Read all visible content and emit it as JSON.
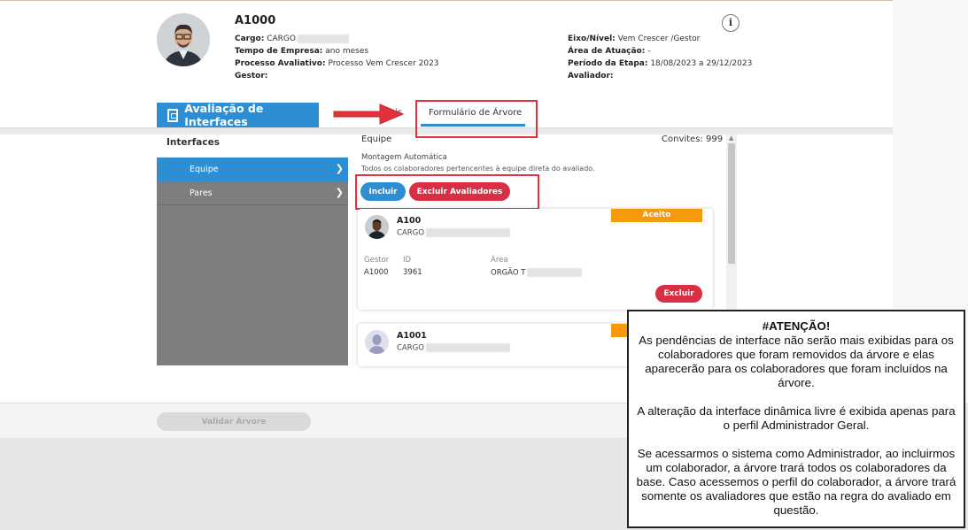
{
  "header": {
    "name": "A1000",
    "left": [
      {
        "label": "Cargo:",
        "value": "CARGO"
      },
      {
        "label": "Tempo de Empresa:",
        "value": "ano meses"
      },
      {
        "label": "Processo Avaliativo:",
        "value": "Processo Vem Crescer 2023"
      },
      {
        "label": "Gestor:",
        "value": ""
      }
    ],
    "right": [
      {
        "label": "Eixo/Nível:",
        "value": "Vem Crescer /Gestor"
      },
      {
        "label": "Área de Atuação:",
        "value": "-"
      },
      {
        "label": "Período da Etapa:",
        "value": "18/08/2023 a 29/12/2023"
      },
      {
        "label": "Avaliador:",
        "value": ""
      }
    ],
    "info_icon": "i"
  },
  "title_tab": "Avaliação de Interfaces",
  "tabs": {
    "left_partial": "ais",
    "tree": "Formulário de Árvore"
  },
  "sidebar": {
    "title": "Interfaces",
    "items": [
      {
        "label": "Equipe"
      },
      {
        "label": "Pares"
      }
    ]
  },
  "main": {
    "title": "Equipe",
    "invites": "Convites: 999",
    "auto_title": "Montagem Automática",
    "auto_desc": "Todos os colaboradores pertencentes à equipe direta do avaliado.",
    "include_label": "Incluir",
    "exclude_all_label": "Excluir Avaliadores"
  },
  "cards": [
    {
      "badge": "Aceito",
      "name": "A100",
      "role": "CARGO",
      "labels": [
        "Gestor",
        "ID",
        "Área"
      ],
      "values": [
        "A1000",
        "3961",
        "ORGÃO T"
      ],
      "exclude_label": "Excluir"
    },
    {
      "badge": "",
      "name": "A1001",
      "role": "CARGO"
    }
  ],
  "validate_label": "Validar Árvore",
  "note": {
    "title": "#ATENÇÃO!",
    "p1": "As pendências de interface não serão mais exibidas para os colaboradores que foram removidos da árvore e elas aparecerão para os colaboradores que foram incluídos na árvore.",
    "p2": "A alteração da interface dinâmica livre é exibida apenas para o perfil Administrador Geral.",
    "p3": "Se acessarmos o sistema como Administrador, ao incluirmos um colaborador, a árvore trará todos os colaboradores da base. Caso acessemos o perfil do colaborador, a árvore trará somente os avaliadores que estão na regra do avaliado em questão."
  }
}
